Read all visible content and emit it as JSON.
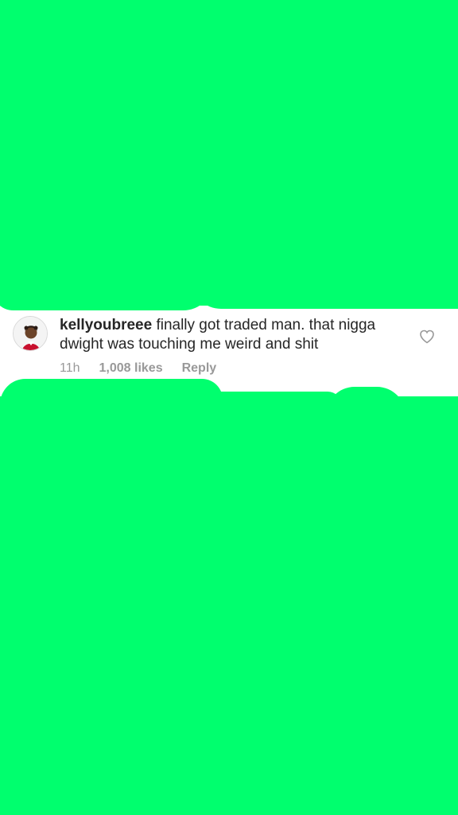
{
  "comment": {
    "username": "kellyoubreee",
    "text": " finally got traded man. that nigga dwight was touching me weird and shit",
    "timestamp": "11h",
    "likes": "1,008 likes",
    "reply_label": "Reply",
    "like_icon": "heart-outline-icon",
    "avatar_icon": "profile-photo-avatar"
  },
  "colors": {
    "overlay_green": "#00ff6e",
    "strip_background": "#ffffff",
    "text_primary": "#262626",
    "text_secondary": "#999999"
  }
}
